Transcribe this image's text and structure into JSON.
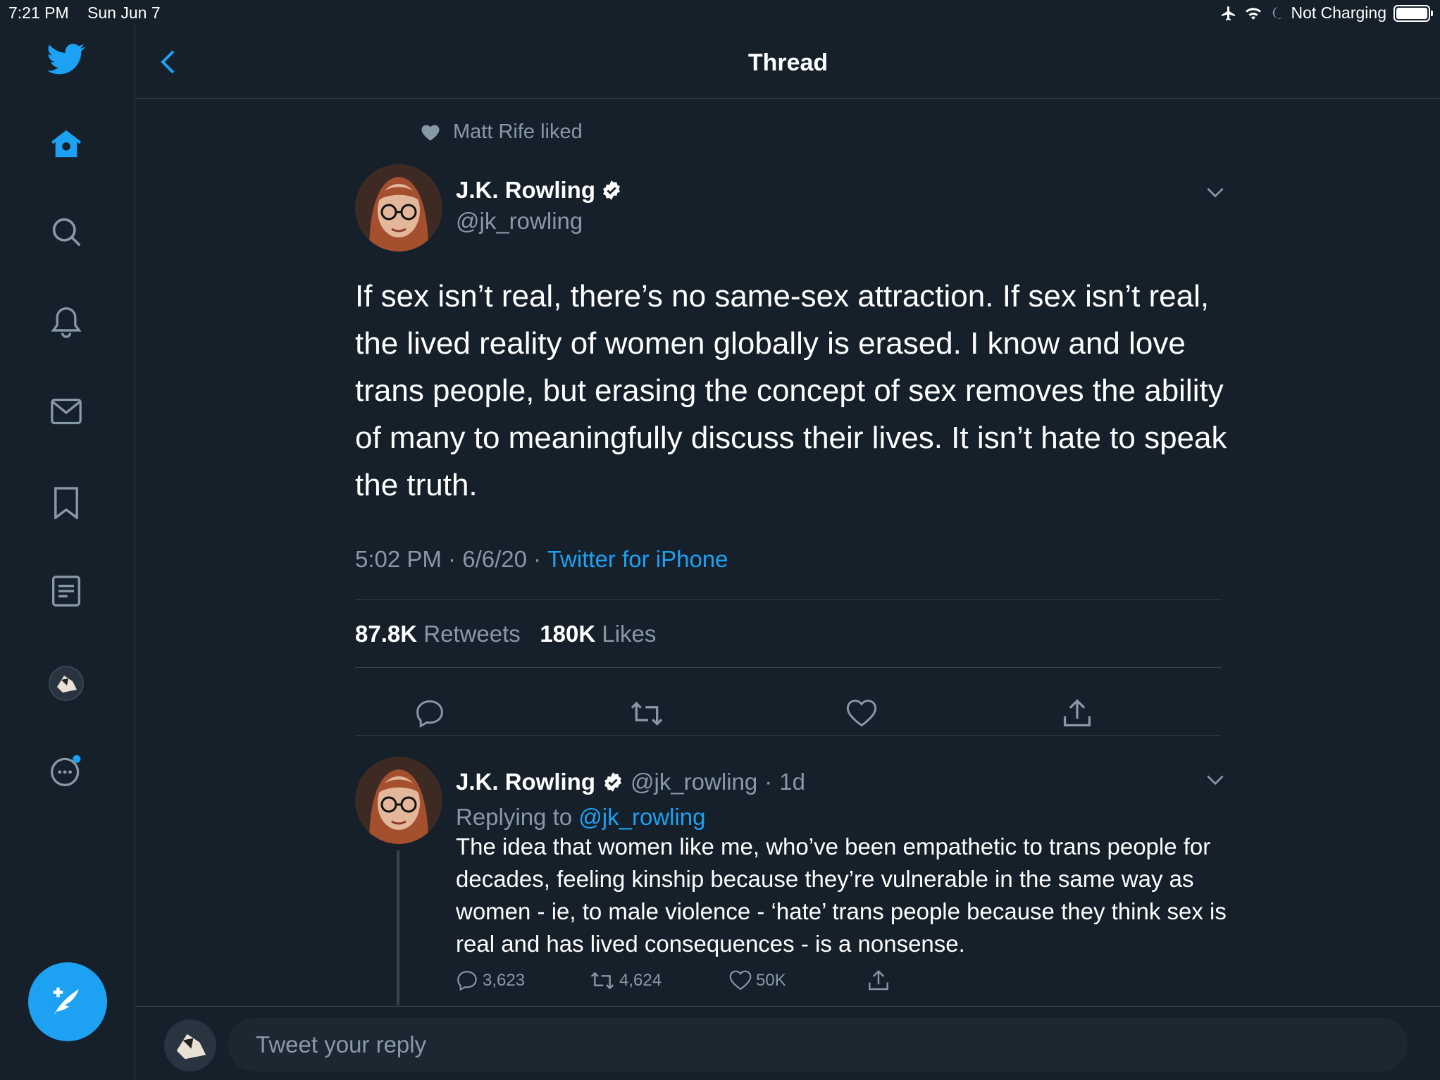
{
  "status_bar": {
    "time": "7:21 PM",
    "date": "Sun Jun 7",
    "battery_text": "Not Charging"
  },
  "header": {
    "title": "Thread"
  },
  "social_context": "Matt Rife liked",
  "tweet": {
    "author_name": "J.K. Rowling",
    "handle": "@jk_rowling",
    "text": "If sex isn’t real, there’s no same-sex attraction. If sex isn’t real, the lived reality of women globally is erased. I know and love trans people, but erasing the concept of sex removes the ability of many to meaningfully discuss their lives. It isn’t hate to speak the truth.",
    "time": "5:02 PM",
    "date": "6/6/20",
    "source": "Twitter for iPhone",
    "retweets_count": "87.8K",
    "retweets_label": "Retweets",
    "likes_count": "180K",
    "likes_label": "Likes"
  },
  "reply": {
    "author_name": "J.K. Rowling",
    "handle": "@jk_rowling",
    "age": "1d",
    "replying_prefix": "Replying to",
    "replying_handle": "@jk_rowling",
    "text": "The idea that women like me, who’ve been empathetic to trans people for decades, feeling kinship because they’re vulnerable in the same way as women - ie, to male violence - ‘hate’ trans people because they think sex is real and has lived consequences - is a nonsense.",
    "reply_count": "3,623",
    "retweet_count": "4,624",
    "like_count": "50K"
  },
  "composer": {
    "placeholder": "Tweet your reply"
  },
  "colors": {
    "background": "#15202b",
    "accent": "#1da1f2",
    "muted": "#8899a6",
    "border": "#38444d"
  }
}
